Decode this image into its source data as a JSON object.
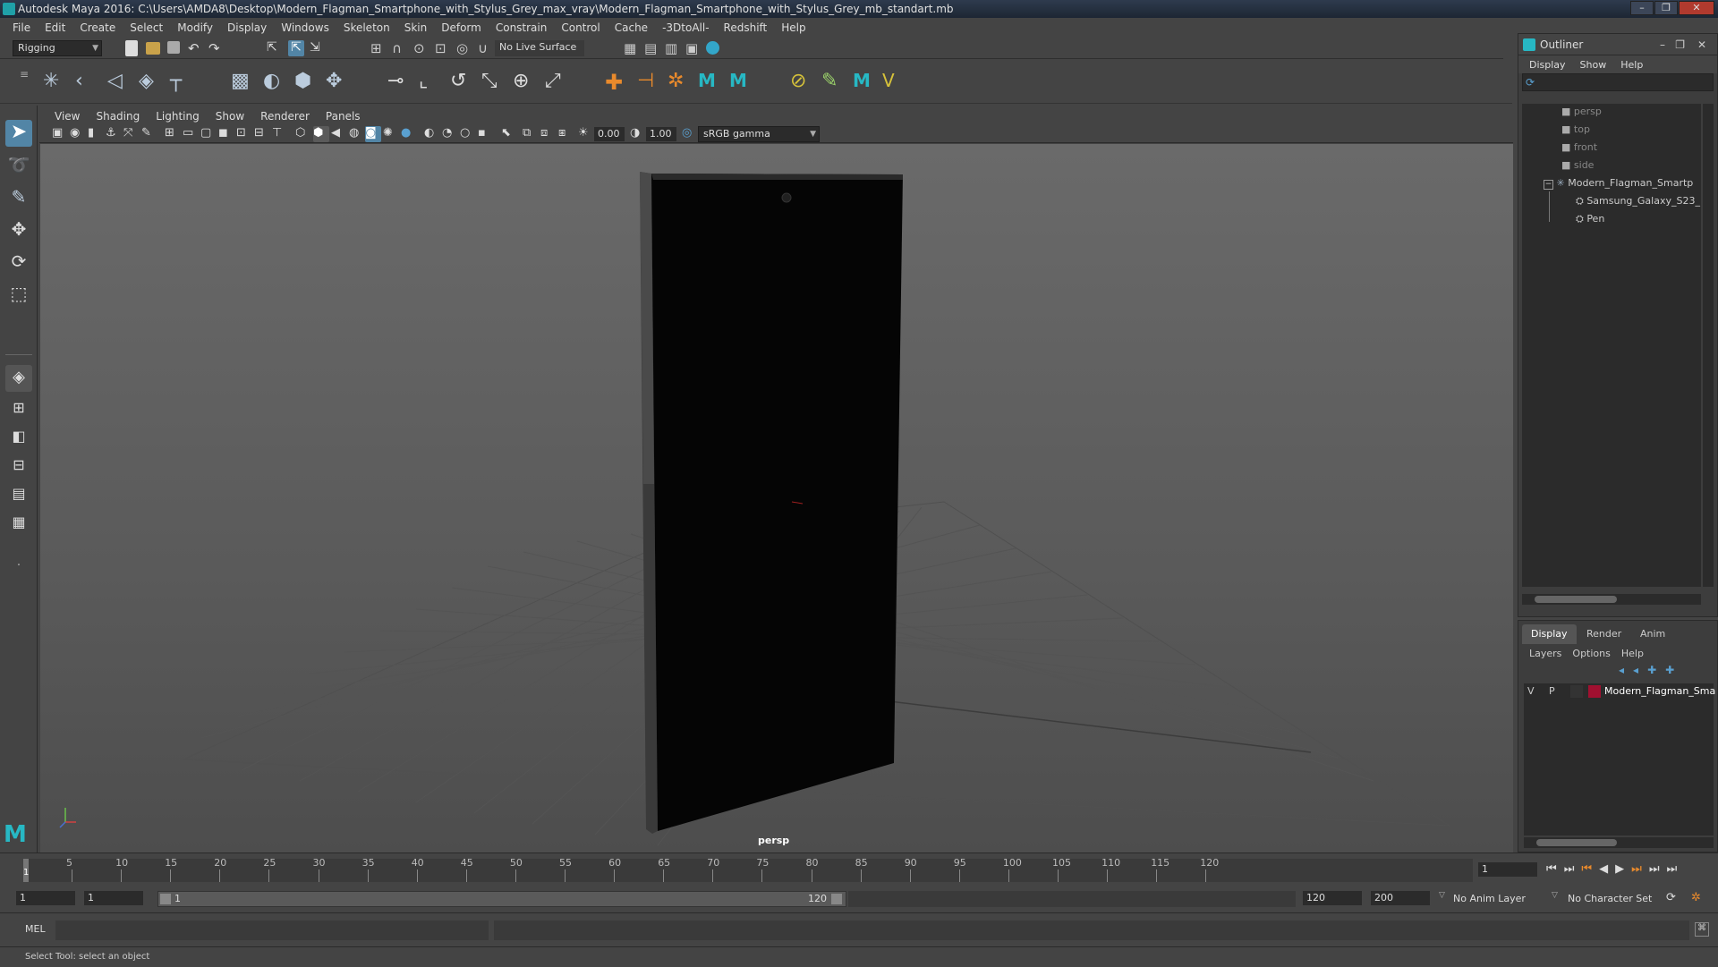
{
  "window": {
    "title": "Autodesk Maya 2016: C:\\Users\\AMDA8\\Desktop\\Modern_Flagman_Smartphone_with_Stylus_Grey_max_vray\\Modern_Flagman_Smartphone_with_Stylus_Grey_mb_standart.mb",
    "minimize": "–",
    "restore": "❐",
    "close": "✕"
  },
  "menubar": [
    "File",
    "Edit",
    "Create",
    "Select",
    "Modify",
    "Display",
    "Windows",
    "Skeleton",
    "Skin",
    "Deform",
    "Constrain",
    "Control",
    "Cache",
    "-3DtoAll-",
    "Redshift",
    "Help"
  ],
  "statusline": {
    "mode": "Rigging",
    "live_surface": "No Live Surface"
  },
  "panel": {
    "menus": [
      "View",
      "Shading",
      "Lighting",
      "Show",
      "Renderer",
      "Panels"
    ],
    "exposure": "0.00",
    "gamma": "1.00",
    "colorspace": "sRGB gamma",
    "camera_label": "persp"
  },
  "outliner": {
    "title": "Outliner",
    "menus": [
      "Display",
      "Show",
      "Help"
    ],
    "items": [
      {
        "label": "persp",
        "dim": true,
        "indent": 0
      },
      {
        "label": "top",
        "dim": true,
        "indent": 0
      },
      {
        "label": "front",
        "dim": true,
        "indent": 0
      },
      {
        "label": "side",
        "dim": true,
        "indent": 0
      },
      {
        "label": "Modern_Flagman_Smartp",
        "dim": false,
        "indent": 0
      },
      {
        "label": "Samsung_Galaxy_S23_",
        "dim": false,
        "indent": 1
      },
      {
        "label": "Pen",
        "dim": false,
        "indent": 1
      }
    ]
  },
  "layers": {
    "tabs": [
      "Display",
      "Render",
      "Anim"
    ],
    "menus": [
      "Layers",
      "Options",
      "Help"
    ],
    "layer": {
      "v": "V",
      "p": "P",
      "name": "Modern_Flagman_Sma",
      "color": "#a01030"
    }
  },
  "timeline": {
    "ticks": [
      "5",
      "10",
      "15",
      "20",
      "25",
      "30",
      "35",
      "40",
      "45",
      "50",
      "55",
      "60",
      "65",
      "70",
      "75",
      "80",
      "85",
      "90",
      "95",
      "100",
      "105",
      "110",
      "115",
      "120"
    ],
    "start_marker": "1",
    "current_frame": "1"
  },
  "range": {
    "start": "1",
    "playback_start": "1",
    "slider_start": "1",
    "slider_end": "120",
    "playback_end": "120",
    "end": "200",
    "anim_layer": "No Anim Layer",
    "character_set": "No Character Set"
  },
  "cmd": {
    "label": "MEL",
    "help": "Select Tool: select an object"
  },
  "colors": {
    "accent": "#5285a6",
    "selection": "#5285a6"
  }
}
